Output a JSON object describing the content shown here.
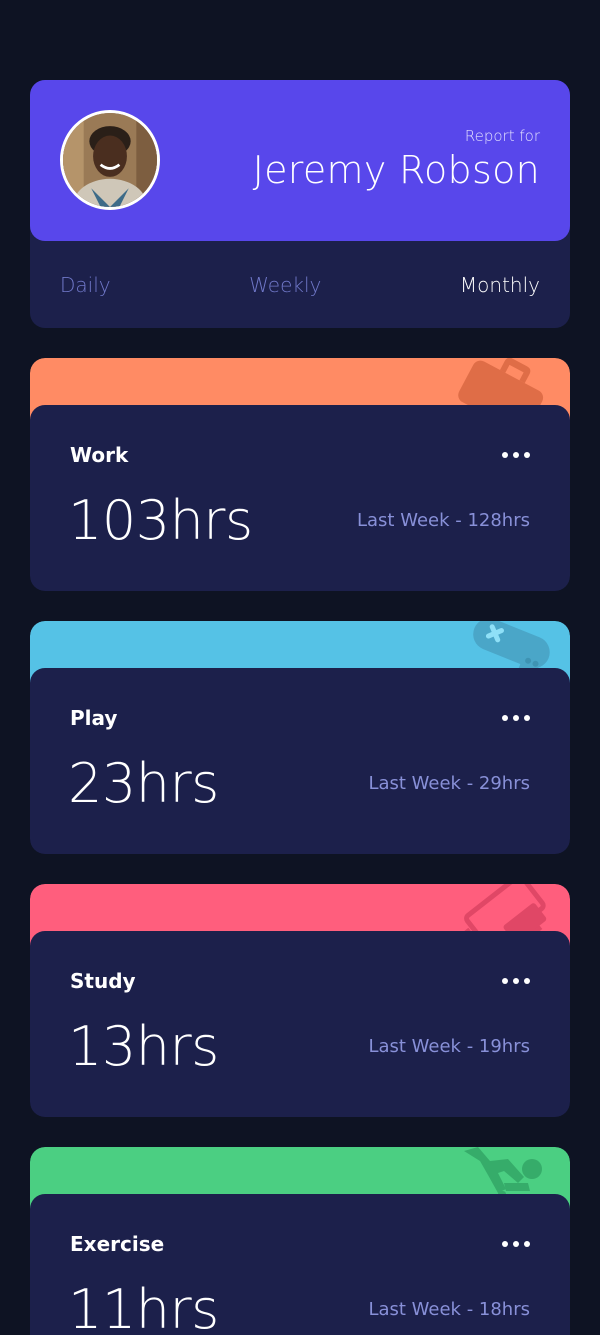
{
  "profile": {
    "report_for": "Report for",
    "name": "Jeremy Robson",
    "avatar_icon": "person-avatar"
  },
  "periods": {
    "daily": "Daily",
    "weekly": "Weekly",
    "monthly": "Monthly",
    "selected": "Monthly"
  },
  "activities": [
    {
      "title": "Work",
      "current": "103hrs",
      "previous": "Last Week - 128hrs",
      "color": "#ff8b64",
      "icon": "briefcase-icon"
    },
    {
      "title": "Play",
      "current": "23hrs",
      "previous": "Last Week - 29hrs",
      "color": "#55c2e6",
      "icon": "gamepad-icon"
    },
    {
      "title": "Study",
      "current": "13hrs",
      "previous": "Last Week - 19hrs",
      "color": "#ff5e7d",
      "icon": "book-icon"
    },
    {
      "title": "Exercise",
      "current": "11hrs",
      "previous": "Last Week - 18hrs",
      "color": "#4bcf82",
      "icon": "runner-icon"
    }
  ],
  "colors": {
    "background": "#0e1323",
    "card": "#1c204b",
    "accent": "#5847eb",
    "muted_text": "#7078c9"
  }
}
